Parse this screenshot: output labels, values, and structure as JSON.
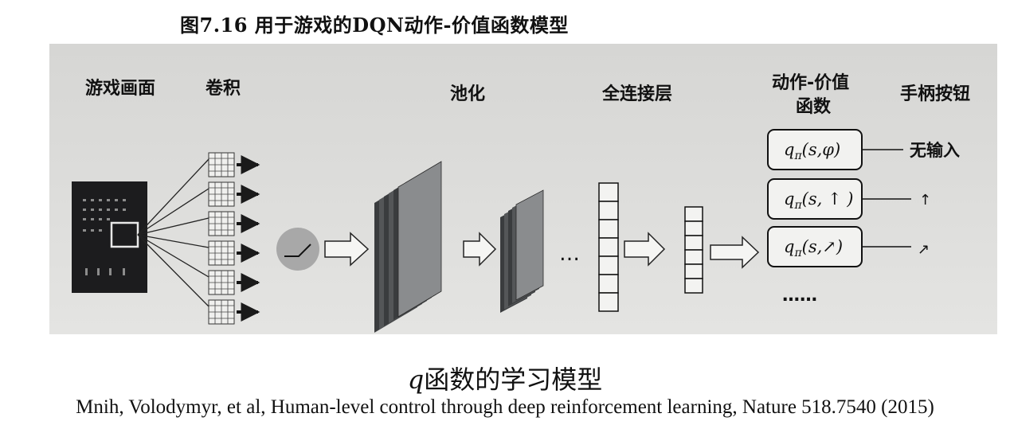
{
  "figure_title": "图7.16 用于游戏的DQN动作-价值函数模型",
  "stage_labels": {
    "game_screen": "游戏画面",
    "convolution": "卷积",
    "pooling": "池化",
    "fully_connected": "全连接层",
    "action_value_line1": "动作-价值",
    "action_value_line2": "函数",
    "joystick_buttons": "手柄按钮"
  },
  "q_functions": [
    {
      "prefix": "q",
      "sub": "π",
      "args": "(s,φ)",
      "output": "无输入"
    },
    {
      "prefix": "q",
      "sub": "π",
      "args": "(s, ↑ )",
      "output": "↑"
    },
    {
      "prefix": "q",
      "sub": "π",
      "args": "(s,↗)",
      "output": "↗"
    }
  ],
  "ellipsis_pooling": "…",
  "ellipsis_q": "……",
  "caption": {
    "q": "q",
    "rest": "函数的学习模型"
  },
  "citation": "Mnih, Volodymyr, et al, Human-level control through deep reinforcement learning, Nature  518.7540 (2015)",
  "colors": {
    "panel_bg": "#dcdcda",
    "stroke": "#1a1a1a",
    "layer_dark": "#3a3c3e",
    "layer_light": "#8a8c8e"
  }
}
